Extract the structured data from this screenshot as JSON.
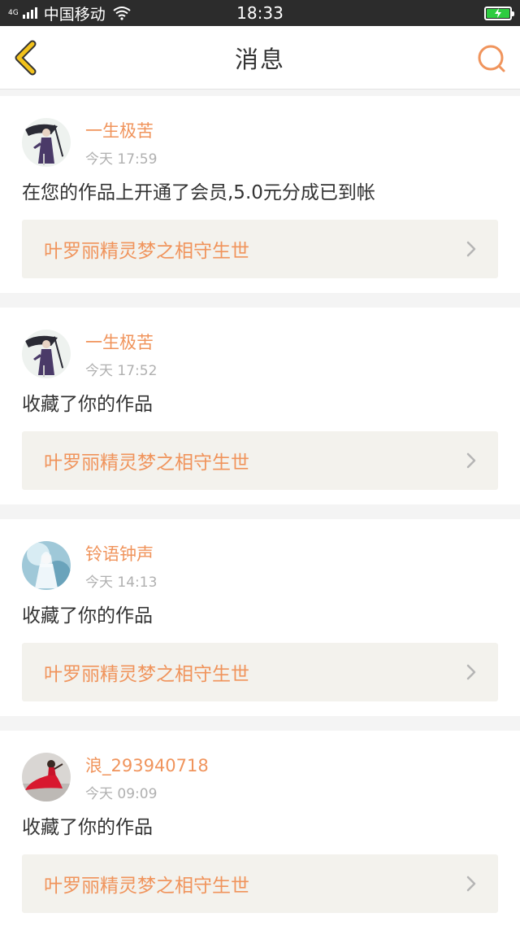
{
  "status_bar": {
    "network": "4G",
    "carrier": "中国移动",
    "time": "18:33",
    "wifi_icon": "wifi-icon",
    "battery_icon": "battery-charging-icon"
  },
  "nav": {
    "title": "消息",
    "back_icon": "chevron-left-icon",
    "search_icon": "search-icon",
    "accent_back": "#f2c21c",
    "accent_search": "#f0945c"
  },
  "messages": [
    {
      "user": "一生极苦",
      "time": "今天 17:59",
      "text": "在您的作品上开通了会员,5.0元分成已到帐",
      "work": "叶罗丽精灵梦之相守生世"
    },
    {
      "user": "一生极苦",
      "time": "今天 17:52",
      "text": "收藏了你的作品",
      "work": "叶罗丽精灵梦之相守生世"
    },
    {
      "user": "铃语钟声",
      "time": "今天 14:13",
      "text": "收藏了你的作品",
      "work": "叶罗丽精灵梦之相守生世"
    },
    {
      "user": "浪_293940718",
      "time": "今天 09:09",
      "text": "收藏了你的作品",
      "work": "叶罗丽精灵梦之相守生世"
    }
  ],
  "colors": {
    "username": "#f0945c",
    "work_link_text": "#f0945c",
    "work_link_bg": "#f3f2ed",
    "timestamp": "#b0b0b0"
  }
}
